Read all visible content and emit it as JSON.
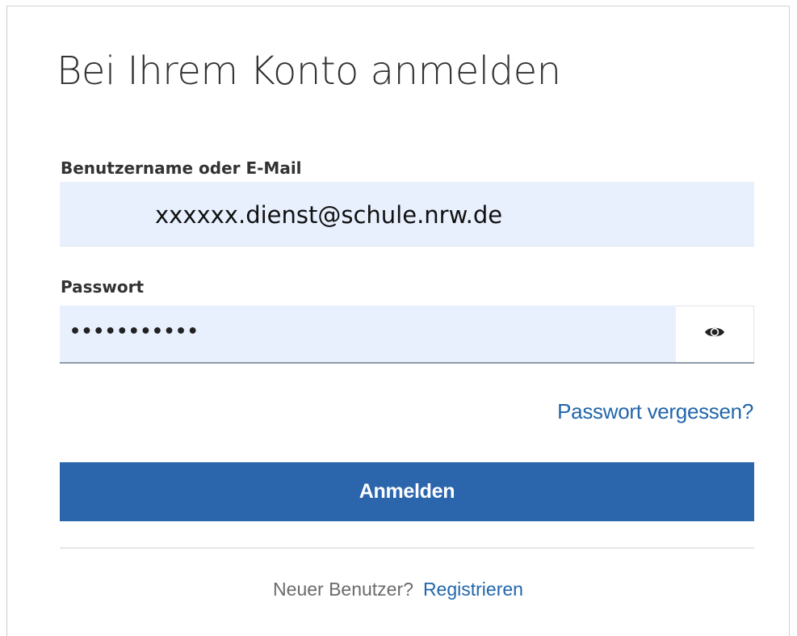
{
  "title": "Bei Ihrem Konto anmelden",
  "username": {
    "label": "Benutzername oder E-Mail",
    "value": "xxxxxx.dienst@schule.nrw.de"
  },
  "password": {
    "label": "Passwort",
    "value": "•••••••••••",
    "toggle_icon": "eye-icon"
  },
  "forgot_password": "Passwort vergessen?",
  "login_button": "Anmelden",
  "register": {
    "question": "Neuer Benutzer?",
    "link": "Registrieren"
  },
  "colors": {
    "accent": "#2b66ad",
    "link": "#2266aa",
    "autofill_bg": "#e8f0fe",
    "text": "#333333"
  }
}
